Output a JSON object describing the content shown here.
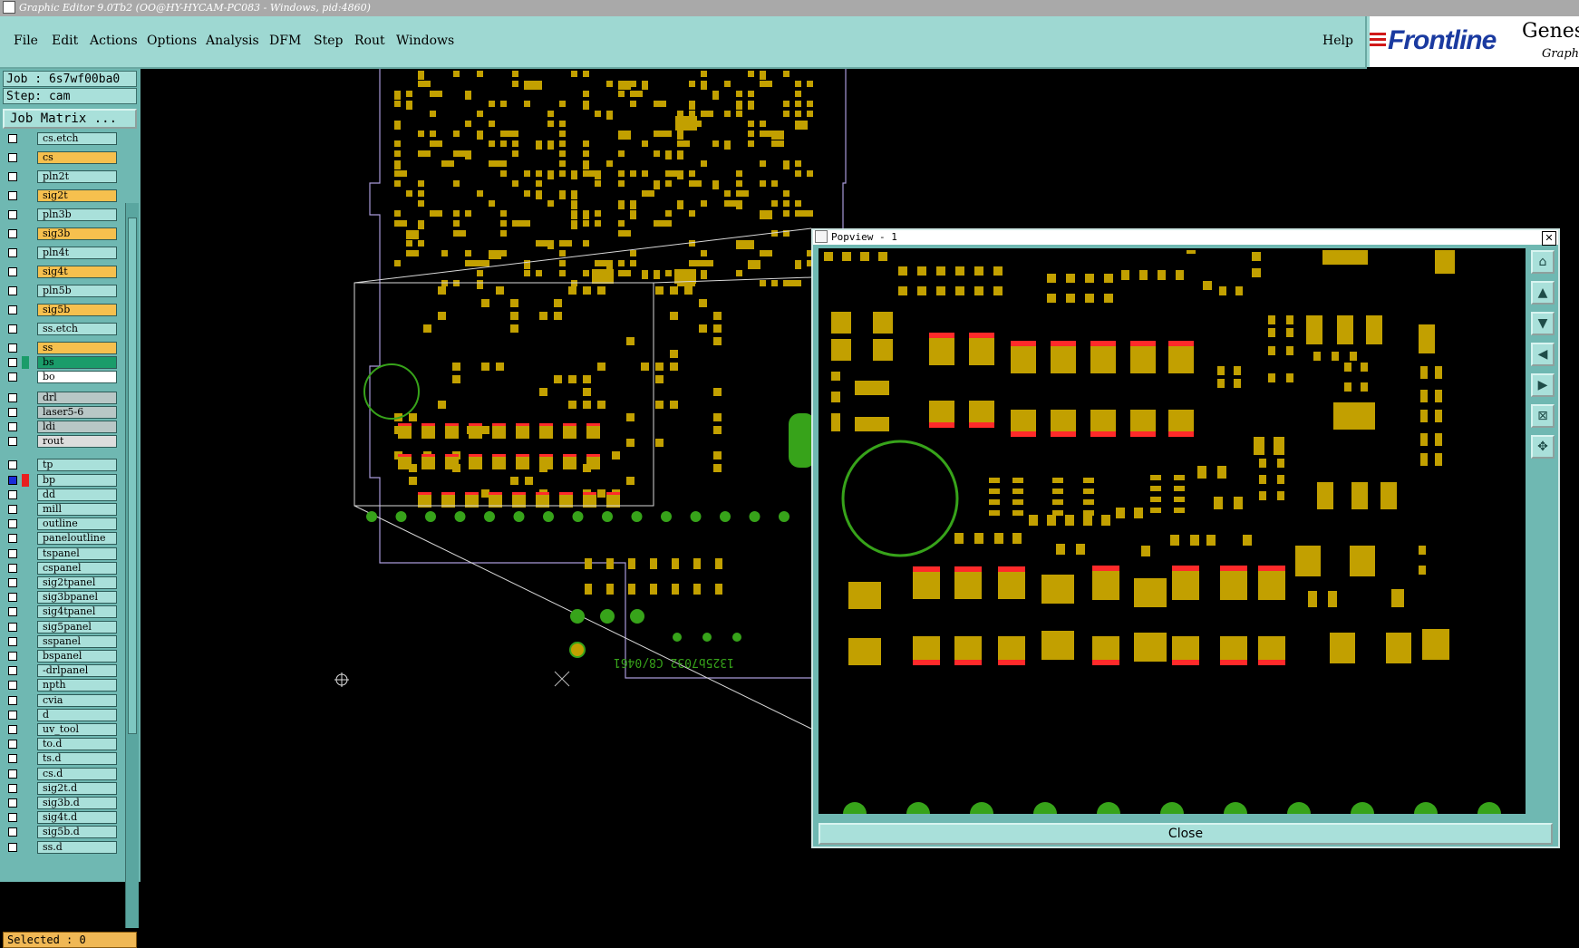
{
  "window": {
    "title": "Graphic Editor 9.0Tb2 (OO@HY-HYCAM-PC083 - Windows, pid:4860)"
  },
  "menu": {
    "file": "File",
    "edit": "Edit",
    "actions": "Actions",
    "options": "Options",
    "analysis": "Analysis",
    "dfm": "DFM",
    "step": "Step",
    "rout": "Rout",
    "windows": "Windows",
    "help": "Help"
  },
  "logo": {
    "brand": "Frontline",
    "product": "Genes",
    "sub": "Graphi"
  },
  "job": {
    "job": "Job : 6s7wf00ba0",
    "step": "Step: cam",
    "matrix_button": "Job Matrix ..."
  },
  "layers": [
    {
      "name": "cs.etch",
      "color": "#a9e0da"
    },
    {
      "name": "cs",
      "color": "#f6c04e"
    },
    {
      "name": "pln2t",
      "color": "#a9e0da"
    },
    {
      "name": "sig2t",
      "color": "#f6c04e"
    },
    {
      "name": "pln3b",
      "color": "#a9e0da"
    },
    {
      "name": "sig3b",
      "color": "#f6c04e"
    },
    {
      "name": "pln4t",
      "color": "#a9e0da"
    },
    {
      "name": "sig4t",
      "color": "#f6c04e"
    },
    {
      "name": "pln5b",
      "color": "#a9e0da"
    },
    {
      "name": "sig5b",
      "color": "#f6c04e"
    },
    {
      "name": "ss.etch",
      "color": "#a9e0da"
    },
    {
      "name": "ss",
      "color": "#f6c04e"
    },
    {
      "name": "bs",
      "color": "#1a9c6a"
    },
    {
      "name": "bo",
      "color": "#ffffff"
    },
    {
      "name": "drl",
      "color": "#b8c7c6"
    },
    {
      "name": "laser5-6",
      "color": "#b8c7c6"
    },
    {
      "name": "ldi",
      "color": "#b8c7c6"
    },
    {
      "name": "rout",
      "color": "#dddddd"
    },
    {
      "name": "tp",
      "color": "#a9e0da"
    },
    {
      "name": "bp",
      "color": "#a9e0da"
    },
    {
      "name": "dd",
      "color": "#a9e0da"
    },
    {
      "name": "mill",
      "color": "#a9e0da"
    },
    {
      "name": "outline",
      "color": "#a9e0da"
    },
    {
      "name": "paneloutline",
      "color": "#a9e0da"
    },
    {
      "name": "tspanel",
      "color": "#a9e0da"
    },
    {
      "name": "cspanel",
      "color": "#a9e0da"
    },
    {
      "name": "sig2tpanel",
      "color": "#a9e0da"
    },
    {
      "name": "sig3bpanel",
      "color": "#a9e0da"
    },
    {
      "name": "sig4tpanel",
      "color": "#a9e0da"
    },
    {
      "name": "sig5panel",
      "color": "#a9e0da"
    },
    {
      "name": "sspanel",
      "color": "#a9e0da"
    },
    {
      "name": "bspanel",
      "color": "#a9e0da"
    },
    {
      "name": "-drlpanel",
      "color": "#a9e0da"
    },
    {
      "name": "npth",
      "color": "#a9e0da"
    },
    {
      "name": "cvia",
      "color": "#a9e0da"
    },
    {
      "name": "d",
      "color": "#a9e0da"
    },
    {
      "name": "uv_tool",
      "color": "#a9e0da"
    },
    {
      "name": "to.d",
      "color": "#a9e0da"
    },
    {
      "name": "ts.d",
      "color": "#a9e0da"
    },
    {
      "name": "cs.d",
      "color": "#a9e0da"
    },
    {
      "name": "sig2t.d",
      "color": "#a9e0da"
    },
    {
      "name": "sig3b.d",
      "color": "#a9e0da"
    },
    {
      "name": "sig4t.d",
      "color": "#a9e0da"
    },
    {
      "name": "sig5b.d",
      "color": "#a9e0da"
    },
    {
      "name": "ss.d",
      "color": "#a9e0da"
    }
  ],
  "selected": "Selected : 0",
  "canvas": {
    "silkscreen_text": "1325b7032 C8/0461"
  },
  "popview": {
    "title": "Popview - 1",
    "close": "Close",
    "tools": [
      "zoom-home-icon",
      "page-up-icon",
      "page-down-icon",
      "page-left-icon",
      "page-right-icon",
      "zoom-fit-icon",
      "pan-icon"
    ]
  },
  "colors": {
    "pad": "#c2a000",
    "solder": "#ff2a2a",
    "via": "#37a31a",
    "outline": "#a89ad8",
    "panel": "#6fb8b2"
  }
}
